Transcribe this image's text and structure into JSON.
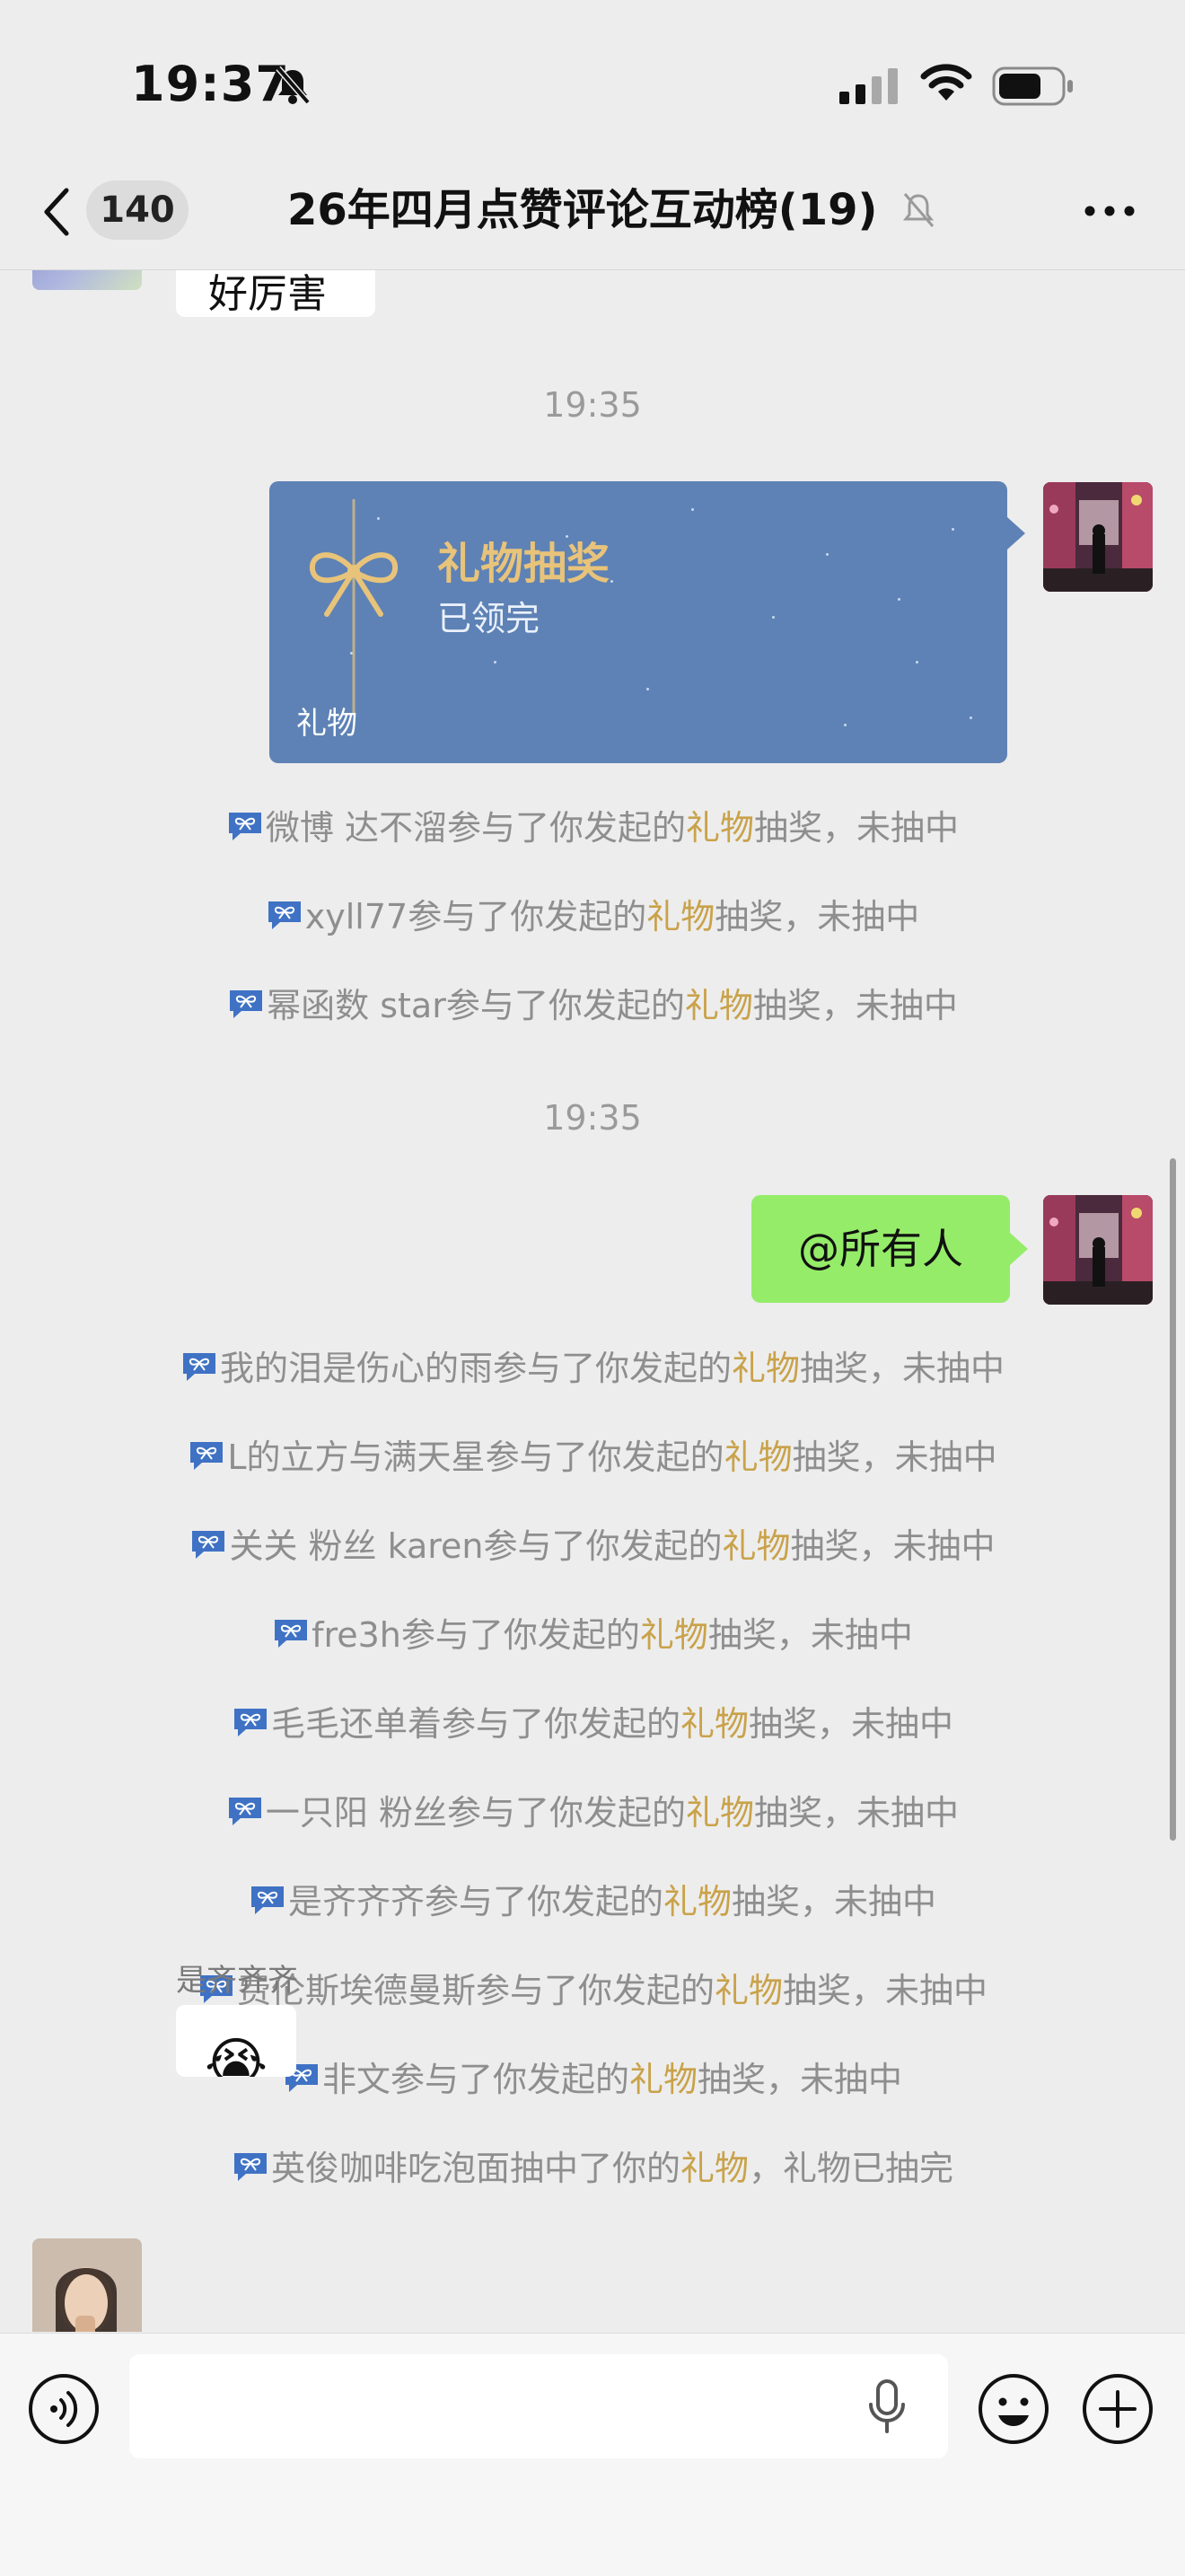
{
  "status": {
    "time": "19:37"
  },
  "nav": {
    "badge": "140",
    "title": "26年四月点赞评论互动榜(19)"
  },
  "chat": {
    "top_partial_text": "好厉害",
    "timestamp1": "19:35",
    "gift_card": {
      "title": "礼物抽奖",
      "subtitle": "已领完",
      "label": "礼物"
    },
    "system_messages_1": [
      {
        "name": "微博 达不溜",
        "pre": "参与了你发起的",
        "gift": "礼物",
        "post": "抽奖，未抽中"
      },
      {
        "name": "xyll77",
        "pre": "参与了你发起的",
        "gift": "礼物",
        "post": "抽奖，未抽中"
      },
      {
        "name": "幂函数 star",
        "pre": "参与了你发起的",
        "gift": "礼物",
        "post": "抽奖，未抽中"
      }
    ],
    "timestamp2": "19:35",
    "mention_message": "@所有人",
    "system_messages_2": [
      {
        "name": "我的泪是伤心的雨",
        "pre": "参与了你发起的",
        "gift": "礼物",
        "post": "抽奖，未抽中"
      },
      {
        "name": "L的立方与满天星",
        "pre": "参与了你发起的",
        "gift": "礼物",
        "post": "抽奖，未抽中"
      },
      {
        "name": "关关 粉丝 karen",
        "pre": "参与了你发起的",
        "gift": "礼物",
        "post": "抽奖，未抽中"
      },
      {
        "name": "fre3h",
        "pre": "参与了你发起的",
        "gift": "礼物",
        "post": "抽奖，未抽中"
      },
      {
        "name": "毛毛还单着",
        "pre": "参与了你发起的",
        "gift": "礼物",
        "post": "抽奖，未抽中"
      },
      {
        "name": "一只阳 粉丝",
        "pre": "参与了你发起的",
        "gift": "礼物",
        "post": "抽奖，未抽中"
      },
      {
        "name": "是齐齐齐",
        "pre": "参与了你发起的",
        "gift": "礼物",
        "post": "抽奖，未抽中"
      },
      {
        "name": "费伦斯埃德曼斯",
        "pre": "参与了你发起的",
        "gift": "礼物",
        "post": "抽奖，未抽中"
      },
      {
        "name": "非文",
        "pre": "参与了你发起的",
        "gift": "礼物",
        "post": "抽奖，未抽中"
      },
      {
        "name": "英俊咖啡吃泡面",
        "pre": "抽中了你的",
        "gift": "礼物",
        "post": "，礼物已抽完"
      }
    ],
    "last_sender_name": "是齐齐齐",
    "last_message_emoji": "😭"
  },
  "colors": {
    "background": "#ededed",
    "gift_card": "#5e82b5",
    "gift_gold": "#e8c37a",
    "gift_word": "#c9a24a",
    "my_bubble": "#95ec69"
  },
  "icons": [
    "bell-off-icon",
    "signal-icon",
    "wifi-icon",
    "battery-icon",
    "back-chevron-icon",
    "more-icon",
    "gift-ribbon-icon",
    "voice-icon",
    "microphone-icon",
    "emoji-icon",
    "plus-icon"
  ]
}
